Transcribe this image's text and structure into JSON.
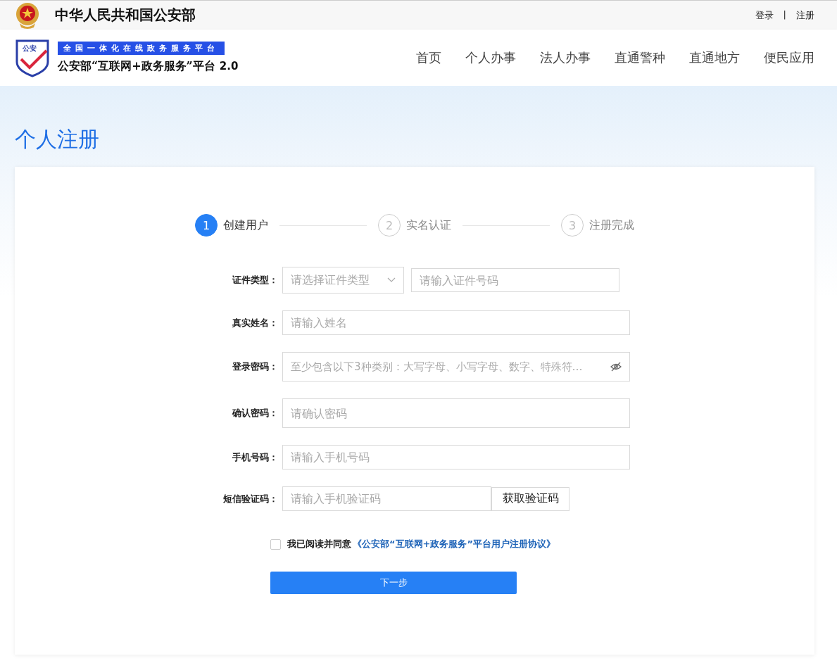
{
  "top_bar": {
    "title": "中华人民共和国公安部",
    "links": [
      "登录",
      "注册"
    ],
    "separator": "|"
  },
  "header": {
    "logo_mark": "公安",
    "badge": "全国一体化在线政务服务平台",
    "platform": "公安部“互联网+政务服务”平台",
    "version": "2.0",
    "nav": [
      "首页",
      "个人办事",
      "法人办事",
      "直通警种",
      "直通地方",
      "便民应用"
    ]
  },
  "page_title": "个人注册",
  "steps": [
    {
      "number": "1",
      "label": "创建用户",
      "active": true
    },
    {
      "number": "2",
      "label": "实名认证",
      "active": false
    },
    {
      "number": "3",
      "label": "注册完成",
      "active": false
    }
  ],
  "fields": [
    {
      "kind": "id",
      "label": "证件类型：",
      "select_placeholder": "请选择证件类型",
      "placeholder": "请输入证件号码"
    },
    {
      "kind": "text",
      "label": "真实姓名：",
      "placeholder": "请输入姓名"
    },
    {
      "kind": "password",
      "label": "登录密码：",
      "placeholder": "至少包含以下3种类别：大写字母、小写字母、数字、特殊符…"
    },
    {
      "kind": "tall",
      "label": "确认密码：",
      "placeholder": "请确认密码"
    },
    {
      "kind": "text",
      "label": "手机号码：",
      "placeholder": "请输入手机号码"
    },
    {
      "kind": "sms",
      "label": "短信验证码：",
      "placeholder": "请输入手机验证码",
      "button": "获取验证码"
    }
  ],
  "agreement": {
    "checked": false,
    "text": "我已阅读并同意",
    "link": "《公安部“互联网+政务服务”平台用户注册协议》"
  },
  "submit": "下一步"
}
